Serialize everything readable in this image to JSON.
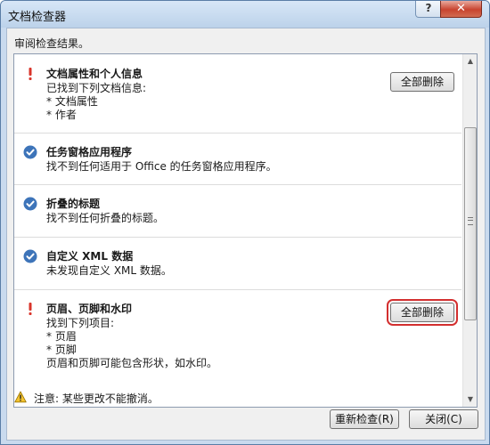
{
  "window": {
    "title": "文档检查器",
    "help_label": "?",
    "close_label": "✕"
  },
  "instruction": "审阅检查结果。",
  "items": [
    {
      "status": "warning",
      "heading": "文档属性和个人信息",
      "lines": [
        "已找到下列文档信息:",
        "* 文档属性",
        "* 作者"
      ],
      "button": "全部删除"
    },
    {
      "status": "ok",
      "heading": "任务窗格应用程序",
      "lines": [
        "找不到任何适用于 Office 的任务窗格应用程序。"
      ]
    },
    {
      "status": "ok",
      "heading": "折叠的标题",
      "lines": [
        "找不到任何折叠的标题。"
      ]
    },
    {
      "status": "ok",
      "heading": "自定义 XML 数据",
      "lines": [
        "未发现自定义 XML 数据。"
      ]
    },
    {
      "status": "warning",
      "heading": "页眉、页脚和水印",
      "lines": [
        "找到下列项目:",
        "* 页眉",
        "* 页脚",
        "页眉和页脚可能包含形状，如水印。"
      ],
      "button": "全部删除"
    }
  ],
  "footer": {
    "warning_text": "注意: 某些更改不能撤消。",
    "reinspect_label": "重新检查(R)",
    "close_label": "关闭(C)"
  },
  "colors": {
    "warning_red": "#d9352b",
    "ok_blue": "#3d74b9",
    "highlight_outline": "#d32f2f"
  }
}
